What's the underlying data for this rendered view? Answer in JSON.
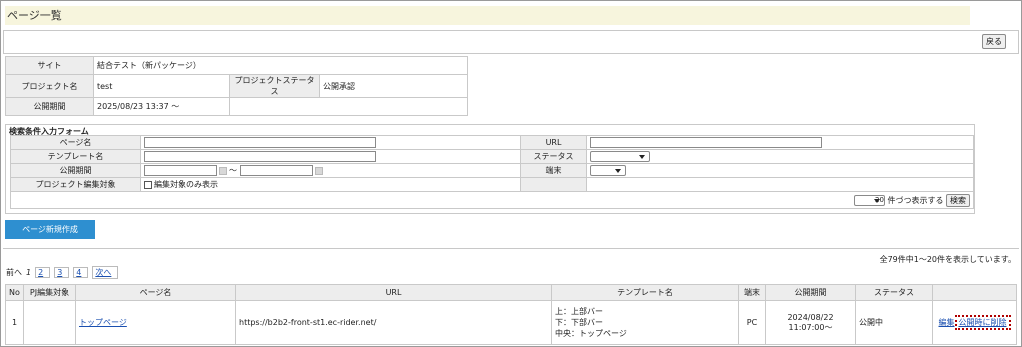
{
  "page": {
    "title": "ページ一覧"
  },
  "toolbar": {
    "back_label": "戻る"
  },
  "info": {
    "site_label": "サイト",
    "site_value": "結合テスト（新パッケージ）",
    "project_label": "プロジェクト名",
    "project_value": "test",
    "project_status_label": "プロジェクトステータス",
    "project_status_value": "公開承認",
    "period_label": "公開期間",
    "period_value": "2025/08/23 13:37 ～"
  },
  "search": {
    "title": "検索条件入力フォーム",
    "page_name_label": "ページ名",
    "url_label": "URL",
    "template_label": "テンプレート名",
    "status_label": "ステータス",
    "period_label": "公開期間",
    "period_sep": "～",
    "device_label": "端末",
    "edit_target_label": "プロジェクト編集対象",
    "edit_only_label": "編集対象のみ表示",
    "per_page_value": "20",
    "per_page_suffix": "件づつ表示する",
    "search_label": "検索"
  },
  "new_page_label": "ページ新規作成",
  "count_text": "全79件中1～20件を表示しています。",
  "pager": {
    "prev": "前へ",
    "current": "1",
    "p2": "2",
    "p3": "3",
    "p4": "4",
    "next": "次へ"
  },
  "table": {
    "headers": [
      "No",
      "PJ編集対象",
      "ページ名",
      "URL",
      "テンプレート名",
      "端末",
      "公開期間",
      "ステータス",
      ""
    ],
    "row": {
      "no": "1",
      "page_name": "トップページ",
      "url": "https://b2b2-front-st1.ec-rider.net/",
      "tpl_line1": "上：上部バー",
      "tpl_line2": "下：下部バー",
      "tpl_line3": "中央：トップページ",
      "device": "PC",
      "period": "2024/08/22 11:07:00～",
      "status": "公開中",
      "edit": "編集",
      "delete": "公開時に削除"
    }
  }
}
